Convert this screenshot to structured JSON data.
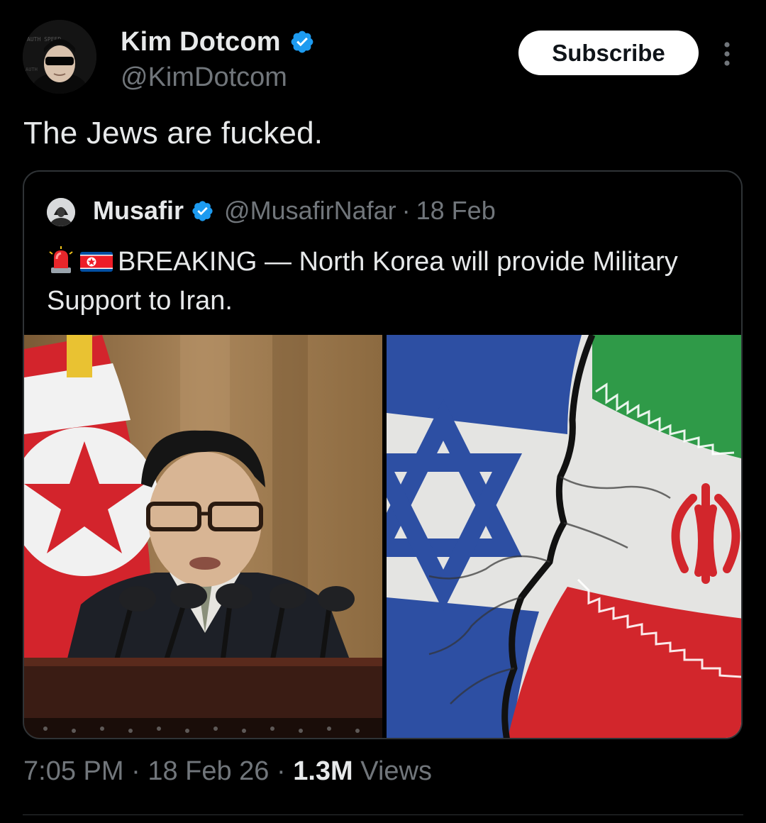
{
  "post": {
    "author": {
      "display_name": "Kim Dotcom",
      "handle": "@KimDotcom",
      "verified": true
    },
    "subscribe_label": "Subscribe",
    "more_icon": "more-vertical-icon",
    "text": "The Jews are fucked.",
    "meta": {
      "time": "7:05 PM",
      "date": "18 Feb 26",
      "separator": "·",
      "views_count": "1.3M",
      "views_label": "Views"
    }
  },
  "quoted_post": {
    "author": {
      "display_name": "Musafir",
      "handle": "@MusafirNafar",
      "verified": true
    },
    "separator": "·",
    "date": "18 Feb",
    "emojis": [
      "police-light-icon",
      "north-korea-flag-icon"
    ],
    "text": "BREAKING — North Korea will provide Military Support to Iran.",
    "media": {
      "left_image": "north-korean-leader-at-podium-with-flag",
      "right_image": "cracked-israel-and-iran-flags",
      "right_image_emblem_text": "الله اكبر"
    }
  },
  "colors": {
    "background": "#000000",
    "text_primary": "#e7e9ea",
    "text_secondary": "#71767b",
    "verified_blue": "#1d9bf0",
    "border": "#2f3336",
    "button_bg": "#ffffff",
    "button_text": "#0f1419"
  }
}
